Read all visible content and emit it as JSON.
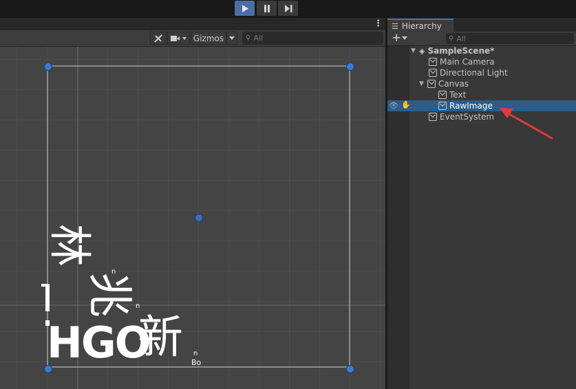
{
  "playbar": {
    "play_icon": "play-icon",
    "pause_icon": "pause-icon",
    "step_icon": "step-icon"
  },
  "scene": {
    "menu_icon": "kebab-menu-icon",
    "tools_icon": "tools-icon",
    "camera_icon": "camera-icon",
    "gizmos_label": "Gizmos",
    "search_placeholder": "All",
    "canvas_text": {
      "vertical_main": "林",
      "vertical_2": "兆",
      "bottom_row": "HGO",
      "right_char": "新",
      "small_n1": "n",
      "small_n2": "n",
      "small_n3": "n",
      "small_bo": "Bo"
    }
  },
  "hierarchy": {
    "tab_label": "Hierarchy",
    "add_label": "+",
    "search_placeholder": "All",
    "items": [
      {
        "label": "SampleScene*",
        "level": 0,
        "expanded": true,
        "bold": true
      },
      {
        "label": "Main Camera",
        "level": 1
      },
      {
        "label": "Directional Light",
        "level": 1
      },
      {
        "label": "Canvas",
        "level": 1,
        "expanded": true
      },
      {
        "label": "Text",
        "level": 2
      },
      {
        "label": "RawImage",
        "level": 2,
        "selected": true
      },
      {
        "label": "EventSystem",
        "level": 1
      }
    ]
  },
  "colors": {
    "selection": "#2c5d87",
    "accent": "#4a6fa8",
    "handle": "#3a7bd5",
    "arrow": "#e03a3a"
  }
}
